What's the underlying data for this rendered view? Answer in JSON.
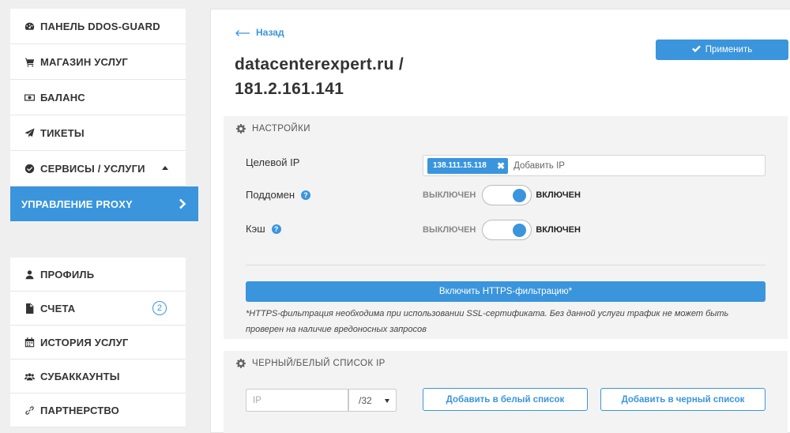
{
  "sidebar": {
    "items": [
      {
        "label": "ПАНЕЛЬ DDOS-GUARD",
        "icon": "dashboard-icon"
      },
      {
        "label": "МАГАЗИН УСЛУГ",
        "icon": "cart-icon"
      },
      {
        "label": "БАЛАНС",
        "icon": "money-icon"
      },
      {
        "label": "ТИКЕТЫ",
        "icon": "paper-plane-icon"
      },
      {
        "label": "СЕРВИСЫ / УСЛУГИ",
        "icon": "check-circle-icon",
        "expanded": true
      },
      {
        "label": "УПРАВЛЕНИЕ PROXY",
        "icon": "chevron-right-icon",
        "active": true
      }
    ],
    "bottom_items": [
      {
        "label": "ПРОФИЛЬ",
        "icon": "user-icon"
      },
      {
        "label": "СЧЕТА",
        "icon": "file-icon",
        "badge": "2"
      },
      {
        "label": "ИСТОРИЯ УСЛУГ",
        "icon": "calendar-icon"
      },
      {
        "label": "СУБАККАУНТЫ",
        "icon": "users-icon"
      },
      {
        "label": "ПАРТНЕРСТВО",
        "icon": "link-icon"
      }
    ]
  },
  "header": {
    "back_label": "Назад",
    "title_line1": "datacenterexpert.ru /",
    "title_line2": "181.2.161.141",
    "apply_label": "Применить"
  },
  "settings": {
    "section_title": "НАСТРОЙКИ",
    "target_ip_label": "Целевой IP",
    "target_ip_tag": "138.111.15.118",
    "target_ip_placeholder": "Добавить IP",
    "subdomain_label": "Поддомен",
    "cache_label": "Кэш",
    "toggle_off_label": "ВЫКЛЮЧЕН",
    "toggle_on_label": "ВКЛЮЧЕН",
    "subdomain_enabled": true,
    "cache_enabled": true,
    "https_button_label": "Включить HTTPS-фильтрацию*",
    "https_note": "*HTTPS-фильтрация необходима при использовании SSL-сертификата. Без данной услуги трафик не может быть проверен на наличие вредоносных запросов"
  },
  "lists": {
    "section_title": "ЧЕРНЫЙ/БЕЛЫЙ СПИСОК IP",
    "ip_placeholder": "IP",
    "mask_value": "/32",
    "whitelist_button": "Добавить в белый список",
    "blacklist_button": "Добавить в черный список"
  },
  "colors": {
    "accent": "#3a95dd",
    "background": "#efefef"
  }
}
